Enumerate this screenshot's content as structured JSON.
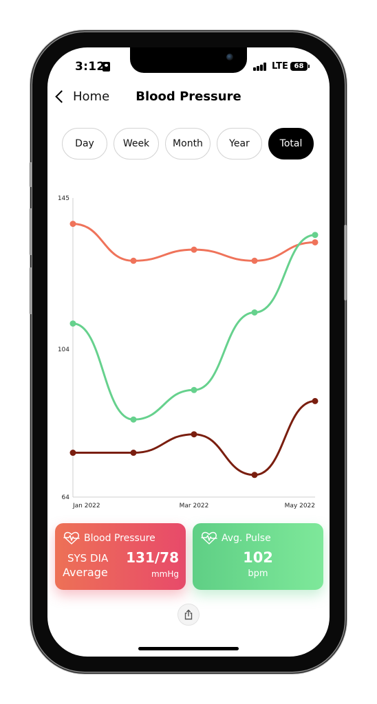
{
  "status_bar": {
    "time": "3:12",
    "network": "LTE",
    "battery": "68"
  },
  "nav": {
    "back_label": "Home",
    "title": "Blood Pressure"
  },
  "tabs": [
    {
      "label": "Day",
      "active": false
    },
    {
      "label": "Week",
      "active": false
    },
    {
      "label": "Month",
      "active": false
    },
    {
      "label": "Year",
      "active": false
    },
    {
      "label": "Total",
      "active": true
    }
  ],
  "chart_data": {
    "type": "line",
    "title": "",
    "xlabel": "",
    "ylabel": "",
    "x": [
      "Jan 2022",
      "Feb 2022",
      "Mar 2022",
      "Apr 2022",
      "May 2022"
    ],
    "x_tick_labels": [
      "Jan 2022",
      "Mar 2022",
      "May 2022"
    ],
    "y_tick_labels": [
      "145",
      "104",
      "64"
    ],
    "ylim": [
      64,
      145
    ],
    "grid": false,
    "smooth": true,
    "series": [
      {
        "name": "Systolic",
        "color": "#ef735a",
        "values": [
          138,
          128,
          131,
          128,
          133
        ]
      },
      {
        "name": "Pulse",
        "color": "#66d18d",
        "values": [
          111,
          85,
          93,
          114,
          135
        ]
      },
      {
        "name": "Diastolic",
        "color": "#7a1e0f",
        "values": [
          76,
          76,
          81,
          70,
          90
        ]
      }
    ]
  },
  "cards": {
    "blood_pressure": {
      "title": "Blood Pressure",
      "label_line1": "SYS DIA",
      "label_line2": "Average",
      "value": "131/78",
      "unit": "mmHg"
    },
    "pulse": {
      "title": "Avg. Pulse",
      "value": "102",
      "unit": "bpm"
    }
  },
  "icons": {
    "share": "share-icon",
    "heart_pulse": "heart-pulse-icon",
    "back": "chevron-left-icon"
  }
}
